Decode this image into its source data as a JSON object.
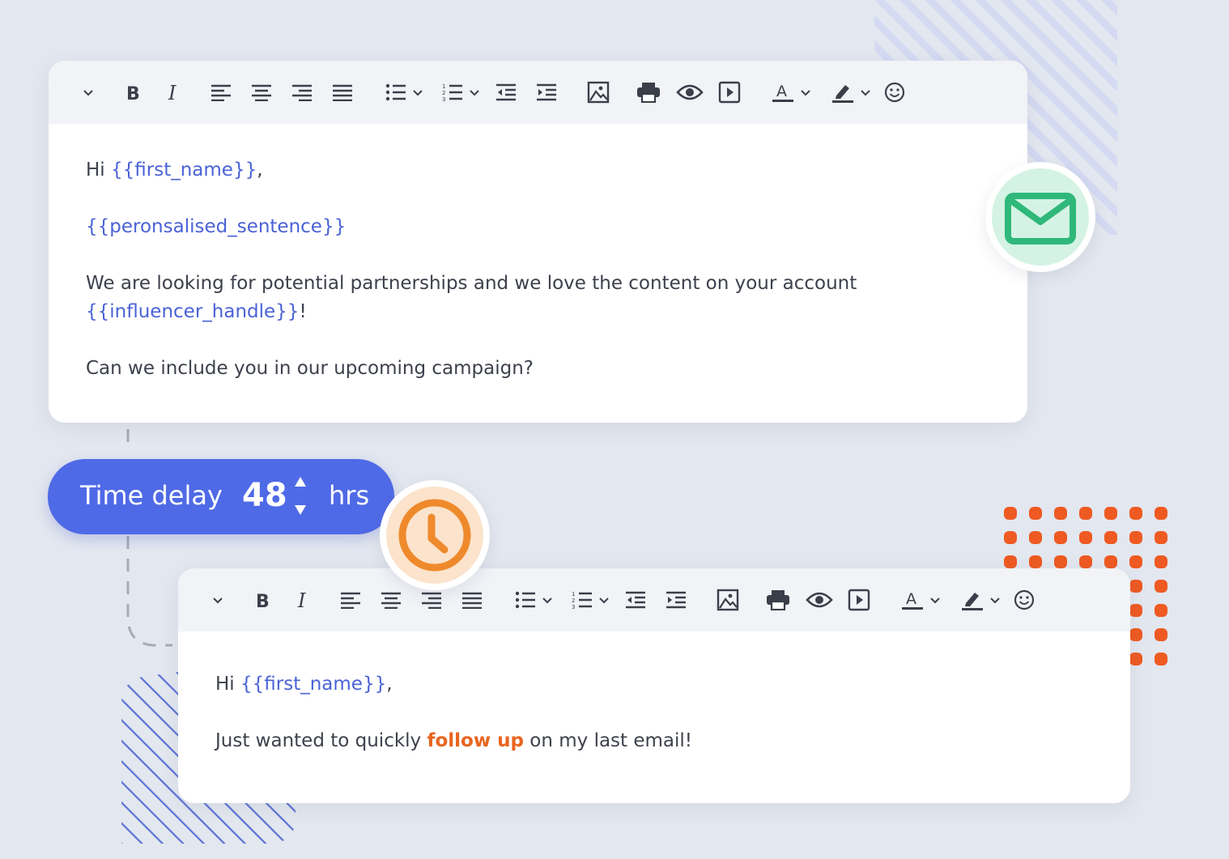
{
  "editor1": {
    "greeting_prefix": "Hi ",
    "greeting_var": "{{first_name}}",
    "greeting_suffix": ",",
    "personal_var": "{{peronsalised_sentence}}",
    "paragraph_text": "We are looking for potential partnerships and we love the content on your account",
    "handle_var": "{{influencer_handle}}",
    "handle_suffix": "!",
    "question": "Can we include you in our upcoming campaign?"
  },
  "delay": {
    "label": "Time delay",
    "value": "48",
    "unit": "hrs"
  },
  "editor2": {
    "greeting_prefix": "Hi ",
    "greeting_var": "{{first_name}}",
    "greeting_suffix": ",",
    "text_before": "Just wanted to quickly ",
    "highlight": "follow up",
    "text_after": " on my last email!"
  },
  "icons": {
    "mail": "envelope-icon",
    "clock": "clock-icon"
  },
  "colors": {
    "accent_blue": "#4f6ae6",
    "variable_blue": "#4a62d6",
    "highlight_orange": "#e8651f",
    "mail_green": "#2fb87a",
    "clock_orange": "#ef8a2c"
  }
}
